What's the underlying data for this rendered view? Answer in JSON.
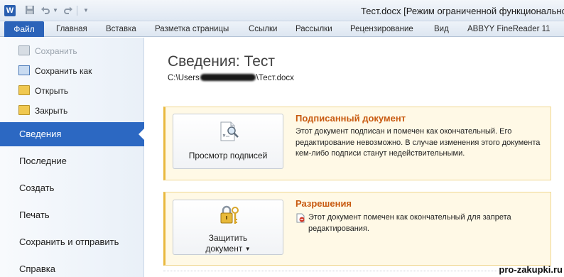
{
  "app": {
    "logo_letter": "W",
    "window_title": "Тест.docx [Режим ограниченной функциональности]"
  },
  "quick_access": {
    "save_icon": "floppy-icon",
    "undo_icon": "undo-icon",
    "redo_icon": "redo-icon",
    "customize_icon": "chevron-down-icon"
  },
  "ribbon": {
    "file_tab": "Файл",
    "tabs": [
      "Главная",
      "Вставка",
      "Разметка страницы",
      "Ссылки",
      "Рассылки",
      "Рецензирование",
      "Вид",
      "ABBYY FineReader 11"
    ]
  },
  "backstage": {
    "commands": [
      {
        "label": "Сохранить",
        "icon": "floppy-icon",
        "disabled": true
      },
      {
        "label": "Сохранить как",
        "icon": "save-as-icon",
        "disabled": false
      },
      {
        "label": "Открыть",
        "icon": "open-folder-icon",
        "disabled": false
      },
      {
        "label": "Закрыть",
        "icon": "close-folder-icon",
        "disabled": false
      }
    ],
    "nav": [
      "Сведения",
      "Последние",
      "Создать",
      "Печать",
      "Сохранить и отправить",
      "Справка"
    ],
    "active_nav": "Сведения"
  },
  "info": {
    "title": "Сведения: Тест",
    "path_prefix": "C:\\Users",
    "path_suffix": "\\Тест.docx"
  },
  "signed_panel": {
    "button_label": "Просмотр подписей",
    "heading": "Подписанный документ",
    "text": "Этот документ подписан и помечен как окончательный. Его редактирование невозможно. В случае изменения этого документа кем-либо подписи станут недействительными."
  },
  "permissions_panel": {
    "button_line1": "Защитить",
    "button_line2": "документ",
    "heading": "Разрешения",
    "text": "Этот документ помечен как окончательный для запрета редактирования."
  },
  "colors": {
    "accent_blue": "#2b63b9",
    "heading_orange": "#c85a10",
    "panel_bg": "#fff9e6",
    "panel_border": "#f0d790"
  },
  "watermark": "pro-zakupki.ru"
}
